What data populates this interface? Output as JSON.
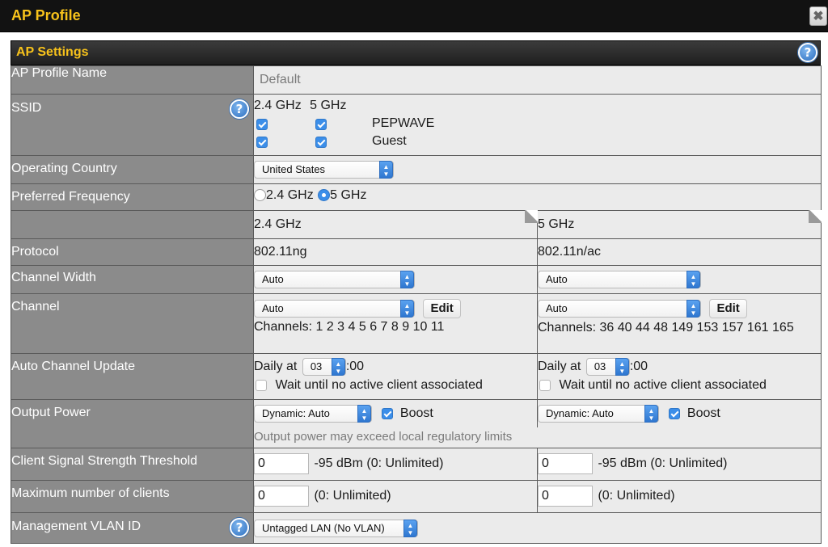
{
  "window": {
    "title": "AP Profile",
    "close_label": "✖"
  },
  "section": {
    "title": "AP Settings",
    "help": "?"
  },
  "profile_name": {
    "label": "AP Profile Name",
    "value": "Default"
  },
  "ssid": {
    "label": "SSID",
    "help": "?",
    "col_24": "2.4 GHz",
    "col_5": "5 GHz",
    "rows": [
      {
        "name": "PEPWAVE",
        "checked_24": true,
        "checked_5": true
      },
      {
        "name": "Guest",
        "checked_24": true,
        "checked_5": true
      }
    ]
  },
  "country": {
    "label": "Operating Country",
    "selected": "United States"
  },
  "frequency": {
    "label": "Preferred Frequency",
    "opt_24": "2.4 GHz",
    "opt_5": "5 GHz",
    "selected": "5 GHz"
  },
  "band_headers": {
    "col_24": "2.4 GHz",
    "col_5": "5 GHz"
  },
  "protocol": {
    "label": "Protocol",
    "val_24": "802.11ng",
    "val_5": "802.11n/ac"
  },
  "channel_width": {
    "label": "Channel Width",
    "sel_24": "Auto",
    "sel_5": "Auto"
  },
  "channel": {
    "label": "Channel",
    "sel_24": "Auto",
    "sel_5": "Auto",
    "edit_label": "Edit",
    "list_24": "Channels: 1 2 3 4 5 6 7 8 9 10 11",
    "list_5": "Channels: 36 40 44 48 149 153 157 161 165"
  },
  "auto_update": {
    "label": "Auto Channel Update",
    "daily_at": "Daily at",
    "hour_24": "03",
    "hour_5": "03",
    "minutes": ":00",
    "wait_label": "Wait until no active client associated",
    "wait_checked": false
  },
  "output_power": {
    "label": "Output Power",
    "sel_24": "Dynamic: Auto",
    "sel_5": "Dynamic: Auto",
    "boost_label": "Boost",
    "boost_24": true,
    "boost_5": true,
    "note": "Output power may exceed local regulatory limits"
  },
  "signal_threshold": {
    "label": "Client Signal Strength Threshold",
    "val_24": "0",
    "val_5": "0",
    "hint": "-95 dBm  (0: Unlimited)"
  },
  "max_clients": {
    "label": "Maximum number of clients",
    "val_24": "0",
    "val_5": "0",
    "hint": "(0: Unlimited)"
  },
  "mgmt_vlan": {
    "label": "Management VLAN ID",
    "help": "?",
    "selected": "Untagged LAN (No VLAN)"
  }
}
